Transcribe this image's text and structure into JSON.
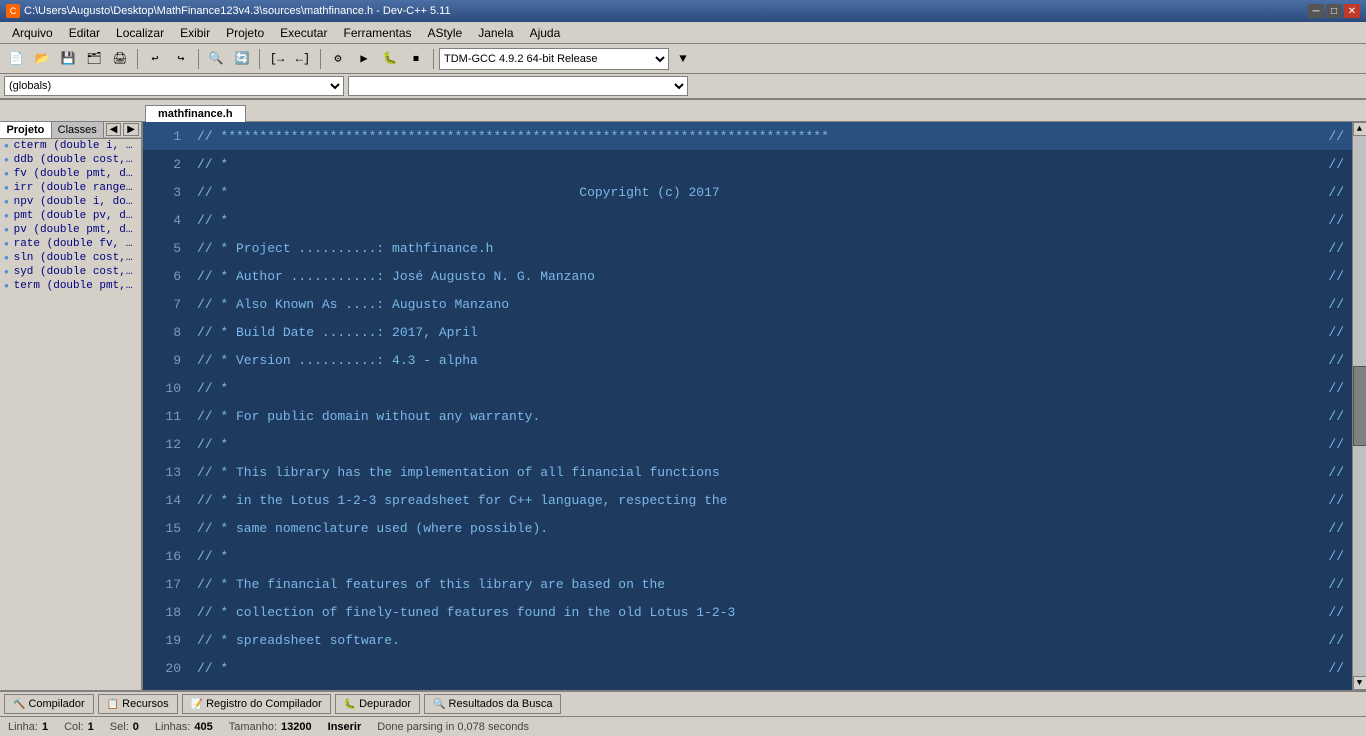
{
  "titleBar": {
    "title": "C:\\Users\\Augusto\\Desktop\\MathFinance123v4.3\\sources\\mathfinance.h - Dev-C++ 5.11",
    "minBtn": "─",
    "maxBtn": "□",
    "closeBtn": "✕"
  },
  "menuBar": {
    "items": [
      "Arquivo",
      "Editar",
      "Localizar",
      "Exibir",
      "Projeto",
      "Executar",
      "Ferramentas",
      "AStyle",
      "Janela",
      "Ajuda"
    ]
  },
  "toolbar": {
    "compilerSelect": "TDM-GCC 4.9.2 64-bit Release"
  },
  "toolbar2": {
    "leftSelect": "(globals)",
    "rightSelect": ""
  },
  "activeTab": "mathfinance.h",
  "sidebar": {
    "tabs": [
      "Projeto",
      "Classes"
    ],
    "items": [
      "cterm (double i, d...",
      "ddb (double cost, d...",
      "fv (double pmt, dou...",
      "irr (double range[], ...",
      "npv (double i, doub...",
      "pmt (double pv, do...",
      "pv (double pmt, do...",
      "rate (double fv, do...",
      "sln (double cost, do...",
      "syd (double cost, d...",
      "term (double pmt, ..."
    ]
  },
  "codeLines": [
    {
      "num": "1",
      "content": "// ******************************************************************************",
      "end": "//"
    },
    {
      "num": "2",
      "content": "// *                                                                          ",
      "end": "//"
    },
    {
      "num": "3",
      "content": "// *                                             Copyright (c) 2017           ",
      "end": "//"
    },
    {
      "num": "4",
      "content": "// *                                                                          ",
      "end": "//"
    },
    {
      "num": "5",
      "content": "// * Project ..........: mathfinance.h                                        ",
      "end": "//"
    },
    {
      "num": "6",
      "content": "// * Author ...........: José Augusto N. G. Manzano                           ",
      "end": "//"
    },
    {
      "num": "7",
      "content": "// * Also Known As ....: Augusto Manzano                                      ",
      "end": "//"
    },
    {
      "num": "8",
      "content": "// * Build Date .......: 2017, April                                          ",
      "end": "//"
    },
    {
      "num": "9",
      "content": "// * Version ..........: 4.3 - alpha                                          ",
      "end": "//"
    },
    {
      "num": "10",
      "content": "// *                                                                          ",
      "end": "//"
    },
    {
      "num": "11",
      "content": "// * For public domain without any warranty.                                  ",
      "end": "//"
    },
    {
      "num": "12",
      "content": "// *                                                                          ",
      "end": "//"
    },
    {
      "num": "13",
      "content": "// * This library has the implementation of all financial functions            ",
      "end": "//"
    },
    {
      "num": "14",
      "content": "// * in the Lotus 1-2-3 spreadsheet for C++ language, respecting the         ",
      "end": "//"
    },
    {
      "num": "15",
      "content": "// * same nomenclature used (where possible).                                 ",
      "end": "//"
    },
    {
      "num": "16",
      "content": "// *                                                                          ",
      "end": "//"
    },
    {
      "num": "17",
      "content": "// * The financial features of this library are based on the                  ",
      "end": "//"
    },
    {
      "num": "18",
      "content": "// * collection of finely-tuned features found in the old Lotus 1-2-3        ",
      "end": "//"
    },
    {
      "num": "19",
      "content": "// * spreadsheet software.                                                    ",
      "end": "//"
    },
    {
      "num": "20",
      "content": "// *                                                                          ",
      "end": "//"
    }
  ],
  "highlightedLine": "1",
  "bottomTabs": [
    {
      "icon": "🔨",
      "label": "Compilador"
    },
    {
      "icon": "📋",
      "label": "Recursos"
    },
    {
      "icon": "📝",
      "label": "Registro do Compilador"
    },
    {
      "icon": "🐛",
      "label": "Depurador"
    },
    {
      "icon": "🔍",
      "label": "Resultados da Busca"
    }
  ],
  "statusBar": {
    "lineLabel": "Linha:",
    "lineVal": "1",
    "colLabel": "Col:",
    "colVal": "1",
    "selLabel": "Sel:",
    "selVal": "0",
    "linesLabel": "Linhas:",
    "linesVal": "405",
    "sizeLabel": "Tamanho:",
    "sizeVal": "13200",
    "insertLabel": "Inserir",
    "parseMsg": "Done parsing in 0,078 seconds"
  }
}
